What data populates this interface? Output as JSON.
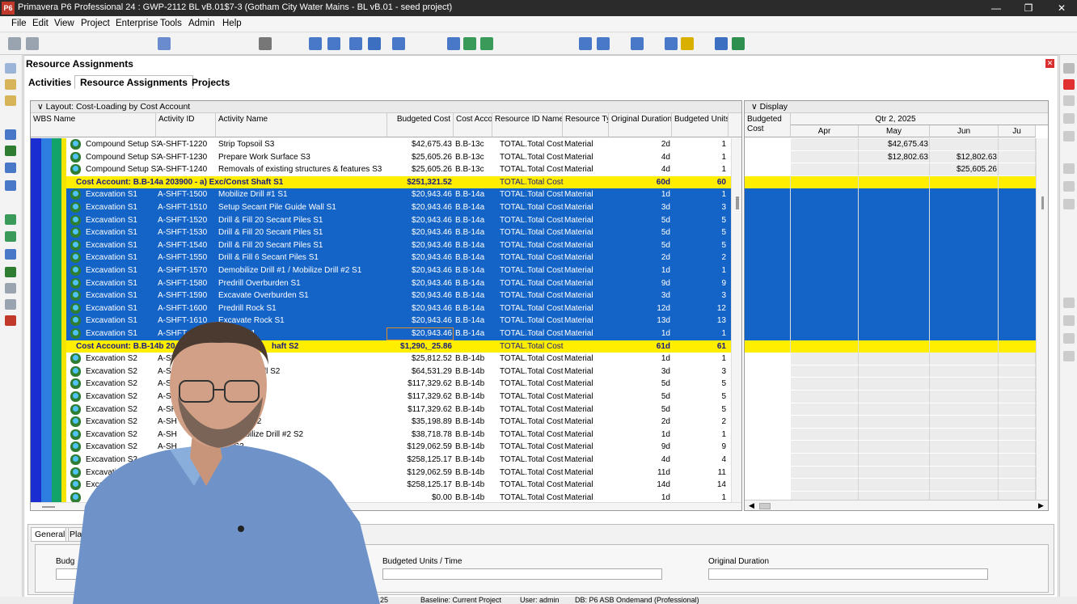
{
  "window": {
    "title": "Primavera P6 Professional 24 : GWP-2112 BL vB.01$7-3 (Gotham City Water Mains - BL vB.01 - seed project)",
    "logo": "P6"
  },
  "menu": [
    "File",
    "Edit",
    "View",
    "Project",
    "Enterprise",
    "Tools",
    "Admin",
    "Help"
  ],
  "panel": {
    "title": "Resource Assignments",
    "tabs": [
      "Activities",
      "Resource Assignments",
      "Projects"
    ]
  },
  "left_grid": {
    "layout_label": "Layout: Cost-Loading by Cost Account",
    "columns": [
      "WBS Name",
      "Activity ID",
      "Activity Name",
      "Budgeted Cost",
      "Cost Acco",
      "Resource ID Name",
      "Resource Ty",
      "Original Duration",
      "Budgeted Units"
    ],
    "rows": [
      {
        "type": "norm",
        "wbs": "Compound Setup S3",
        "id": "A-SHFT-1220",
        "name": "Strip Topsoil S3",
        "cost": "$42,675.43",
        "acct": "B.B-13c",
        "res": "TOTAL.Total Cost",
        "rtype": "Material",
        "dur": "2d",
        "units": "1"
      },
      {
        "type": "norm",
        "wbs": "Compound Setup S3",
        "id": "A-SHFT-1230",
        "name": "Prepare Work Surface S3",
        "cost": "$25,605.26",
        "acct": "B.B-13c",
        "res": "TOTAL.Total Cost",
        "rtype": "Material",
        "dur": "4d",
        "units": "1"
      },
      {
        "type": "norm",
        "wbs": "Compound Setup S3",
        "id": "A-SHFT-1240",
        "name": "Removals of existing structures & features S3",
        "cost": "$25,605.26",
        "acct": "B.B-13c",
        "res": "TOTAL.Total Cost",
        "rtype": "Material",
        "dur": "4d",
        "units": "1"
      },
      {
        "type": "grp",
        "label": "Cost Account: B.B-14a  203900 - a) Exc/Const Shaft S1",
        "cost": "$251,321.52",
        "res": "TOTAL.Total Cost",
        "dur": "60d",
        "units": "60"
      },
      {
        "type": "sel",
        "wbs": "Excavation S1",
        "id": "A-SHFT-1500",
        "name": "Mobilize Drill #1 S1",
        "cost": "$20,943.46",
        "acct": "B.B-14a",
        "res": "TOTAL.Total Cost",
        "rtype": "Material",
        "dur": "1d",
        "units": "1"
      },
      {
        "type": "sel",
        "wbs": "Excavation S1",
        "id": "A-SHFT-1510",
        "name": "Setup Secant Pile Guide Wall S1",
        "cost": "$20,943.46",
        "acct": "B.B-14a",
        "res": "TOTAL.Total Cost",
        "rtype": "Material",
        "dur": "3d",
        "units": "3"
      },
      {
        "type": "sel",
        "wbs": "Excavation S1",
        "id": "A-SHFT-1520",
        "name": "Drill & Fill 20 Secant Piles S1",
        "cost": "$20,943.46",
        "acct": "B.B-14a",
        "res": "TOTAL.Total Cost",
        "rtype": "Material",
        "dur": "5d",
        "units": "5"
      },
      {
        "type": "sel",
        "wbs": "Excavation S1",
        "id": "A-SHFT-1530",
        "name": "Drill & Fill 20 Secant Piles S1",
        "cost": "$20,943.46",
        "acct": "B.B-14a",
        "res": "TOTAL.Total Cost",
        "rtype": "Material",
        "dur": "5d",
        "units": "5"
      },
      {
        "type": "sel",
        "wbs": "Excavation S1",
        "id": "A-SHFT-1540",
        "name": "Drill & Fill 20 Secant Piles S1",
        "cost": "$20,943.46",
        "acct": "B.B-14a",
        "res": "TOTAL.Total Cost",
        "rtype": "Material",
        "dur": "5d",
        "units": "5"
      },
      {
        "type": "sel",
        "wbs": "Excavation S1",
        "id": "A-SHFT-1550",
        "name": "Drill & Fill 6 Secant Piles S1",
        "cost": "$20,943.46",
        "acct": "B.B-14a",
        "res": "TOTAL.Total Cost",
        "rtype": "Material",
        "dur": "2d",
        "units": "2"
      },
      {
        "type": "sel",
        "wbs": "Excavation S1",
        "id": "A-SHFT-1570",
        "name": "Demobilize Drill #1 / Mobilize Drill #2 S1",
        "cost": "$20,943.46",
        "acct": "B.B-14a",
        "res": "TOTAL.Total Cost",
        "rtype": "Material",
        "dur": "1d",
        "units": "1"
      },
      {
        "type": "sel",
        "wbs": "Excavation S1",
        "id": "A-SHFT-1580",
        "name": "Predrill Overburden S1",
        "cost": "$20,943.46",
        "acct": "B.B-14a",
        "res": "TOTAL.Total Cost",
        "rtype": "Material",
        "dur": "9d",
        "units": "9"
      },
      {
        "type": "sel",
        "wbs": "Excavation S1",
        "id": "A-SHFT-1590",
        "name": "Excavate Overburden S1",
        "cost": "$20,943.46",
        "acct": "B.B-14a",
        "res": "TOTAL.Total Cost",
        "rtype": "Material",
        "dur": "3d",
        "units": "3"
      },
      {
        "type": "sel",
        "wbs": "Excavation S1",
        "id": "A-SHFT-1600",
        "name": "Predrill Rock S1",
        "cost": "$20,943.46",
        "acct": "B.B-14a",
        "res": "TOTAL.Total Cost",
        "rtype": "Material",
        "dur": "12d",
        "units": "12"
      },
      {
        "type": "sel",
        "wbs": "Excavation S1",
        "id": "A-SHFT-1610",
        "name": "Excavate Rock S1",
        "cost": "$20,943.46",
        "acct": "B.B-14a",
        "res": "TOTAL.Total Cost",
        "rtype": "Material",
        "dur": "13d",
        "units": "13"
      },
      {
        "type": "sel",
        "wbs": "Excavation S1",
        "id": "A-SHFT-",
        "name": "Drill #2 S1",
        "cost": "$20,943.46",
        "acct": "B.B-14a",
        "res": "TOTAL.Total Cost",
        "rtype": "Material",
        "dur": "1d",
        "units": "1"
      },
      {
        "type": "grp",
        "label": "Cost Account: B.B-14b  20",
        "label2": "haft S2",
        "cost": "$1,290,_25.86",
        "res": "TOTAL.Total Cost",
        "dur": "61d",
        "units": "61"
      },
      {
        "type": "norm",
        "wbs": "Excavation S2",
        "id": "A-SH",
        "name": "S2",
        "cost": "$25,812.52",
        "acct": "B.B-14b",
        "res": "TOTAL.Total Cost",
        "rtype": "Material",
        "dur": "1d",
        "units": "1"
      },
      {
        "type": "norm",
        "wbs": "Excavation S2",
        "id": "A-SH",
        "name": "ile Guide Wall S2",
        "cost": "$64,531.29",
        "acct": "B.B-14b",
        "res": "TOTAL.Total Cost",
        "rtype": "Material",
        "dur": "3d",
        "units": "3"
      },
      {
        "type": "norm",
        "wbs": "Excavation S2",
        "id": "A-SH",
        "name": "cant Piles S2",
        "cost": "$117,329.62",
        "acct": "B.B-14b",
        "res": "TOTAL.Total Cost",
        "rtype": "Material",
        "dur": "5d",
        "units": "5"
      },
      {
        "type": "norm",
        "wbs": "Excavation S2",
        "id": "A-SH",
        "name": "ant Piles S2",
        "cost": "$117,329.62",
        "acct": "B.B-14b",
        "res": "TOTAL.Total Cost",
        "rtype": "Material",
        "dur": "5d",
        "units": "5"
      },
      {
        "type": "norm",
        "wbs": "Excavation S2",
        "id": "A-SH",
        "name": "ant Piles S2",
        "cost": "$117,329.62",
        "acct": "B.B-14b",
        "res": "TOTAL.Total Cost",
        "rtype": "Material",
        "dur": "5d",
        "units": "5"
      },
      {
        "type": "norm",
        "wbs": "Excavation S2",
        "id": "A-SH",
        "name": "ant Piles S2",
        "cost": "$35,198.89",
        "acct": "B.B-14b",
        "res": "TOTAL.Total Cost",
        "rtype": "Material",
        "dur": "2d",
        "units": "2"
      },
      {
        "type": "norm",
        "wbs": "Excavation S2",
        "id": "A-SH",
        "name": "#1 / Mobilize Drill #2 S2",
        "cost": "$38,718.78",
        "acct": "B.B-14b",
        "res": "TOTAL.Total Cost",
        "rtype": "Material",
        "dur": "1d",
        "units": "1"
      },
      {
        "type": "norm",
        "wbs": "Excavation S2",
        "id": "A-SH",
        "name": "den S2",
        "cost": "$129,062.59",
        "acct": "B.B-14b",
        "res": "TOTAL.Total Cost",
        "rtype": "Material",
        "dur": "9d",
        "units": "9"
      },
      {
        "type": "norm",
        "wbs": "Excavation S2",
        "id": "",
        "name": "",
        "cost": "$258,125.17",
        "acct": "B.B-14b",
        "res": "TOTAL.Total Cost",
        "rtype": "Material",
        "dur": "4d",
        "units": "4"
      },
      {
        "type": "norm",
        "wbs": "Excavation",
        "id": "",
        "name": "",
        "cost": "$129,062.59",
        "acct": "B.B-14b",
        "res": "TOTAL.Total Cost",
        "rtype": "Material",
        "dur": "11d",
        "units": "11"
      },
      {
        "type": "norm",
        "wbs": "Exca",
        "id": "",
        "name": "",
        "cost": "$258,125.17",
        "acct": "B.B-14b",
        "res": "TOTAL.Total Cost",
        "rtype": "Material",
        "dur": "14d",
        "units": "14"
      },
      {
        "type": "norm",
        "wbs": "",
        "id": "",
        "name": "",
        "cost": "$0.00",
        "acct": "B.B-14b",
        "res": "TOTAL.Total Cost",
        "rtype": "Material",
        "dur": "1d",
        "units": "1"
      }
    ]
  },
  "right_grid": {
    "layout_label": "Display",
    "col_header": "Budgeted Cost",
    "quarter": "Qtr 2, 2025",
    "months": [
      "Apr",
      "May",
      "Jun",
      "Ju"
    ],
    "cells": [
      {
        "row": 0,
        "may": "$42,675.43",
        "jun": ""
      },
      {
        "row": 1,
        "may": "$12,802.63",
        "jun": "$12,802.63"
      },
      {
        "row": 2,
        "may": "",
        "jun": "$25,605.26"
      }
    ]
  },
  "bottom": {
    "tabs": [
      "General",
      "Plan"
    ],
    "fields": [
      "Budg",
      "Budgeted Units / Time",
      "Original Duration"
    ]
  },
  "status": {
    "items": [
      "25",
      "Baseline: Current Project",
      "User: admin",
      "DB: P6 ASB Ondemand (Professional)"
    ]
  },
  "colors": {
    "selected": "#1464c8",
    "group": "#ffee00",
    "wbs_band": "#1a2dd0"
  }
}
